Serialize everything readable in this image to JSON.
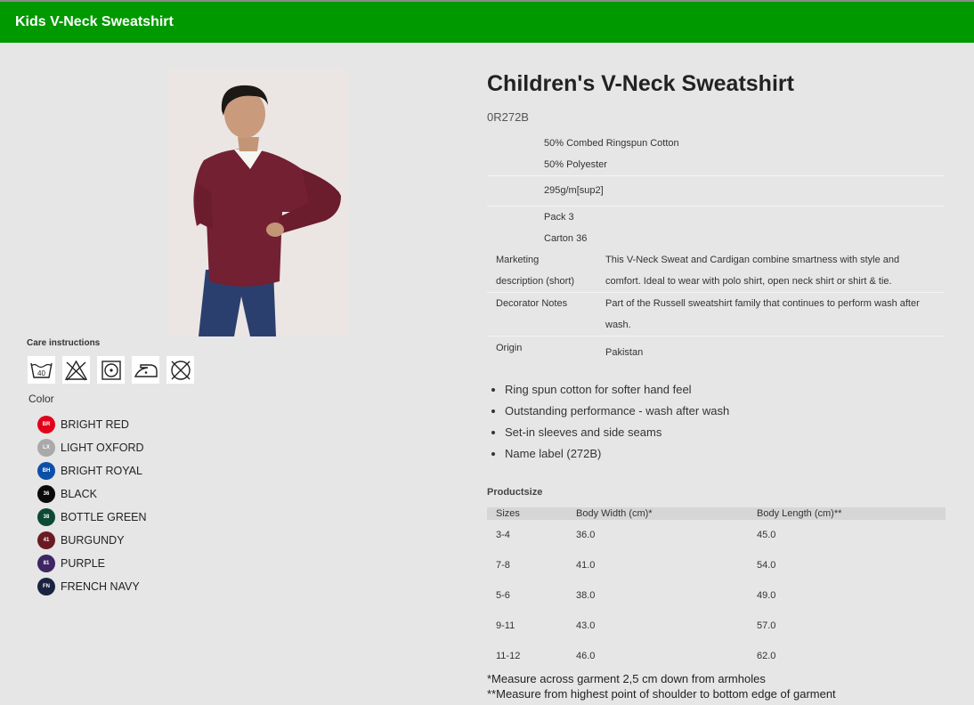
{
  "header": {
    "title": "Kids V-Neck Sweatshirt",
    "bg": "#009900"
  },
  "care": {
    "label": "Care instructions",
    "icons": [
      "wash-40-icon",
      "do-not-bleach-icon",
      "tumble-dry-icon",
      "iron-low-icon",
      "do-not-dry-clean-icon"
    ]
  },
  "colors": {
    "label": "Color",
    "items": [
      {
        "code": "BR",
        "name": "BRIGHT RED",
        "hex": "#e3001b"
      },
      {
        "code": "LX",
        "name": "LIGHT OXFORD",
        "hex": "#a9a9a9"
      },
      {
        "code": "BH",
        "name": "BRIGHT ROYAL",
        "hex": "#0d4fa8"
      },
      {
        "code": "36",
        "name": "BLACK",
        "hex": "#0a0a0a"
      },
      {
        "code": "38",
        "name": "BOTTLE GREEN",
        "hex": "#0d4a34"
      },
      {
        "code": "41",
        "name": "BURGUNDY",
        "hex": "#6b1a24"
      },
      {
        "code": "81",
        "name": "PURPLE",
        "hex": "#3e2563"
      },
      {
        "code": "FN",
        "name": "FRENCH NAVY",
        "hex": "#1a2340"
      }
    ]
  },
  "product": {
    "title": "Children's V-Neck Sweatshirt",
    "code": "0R272B",
    "spec": {
      "material": [
        "50% Combed Ringspun Cotton",
        "50% Polyester"
      ],
      "weight": "295g/m[sup2]",
      "packing": [
        "Pack 3",
        "Carton 36"
      ],
      "marketing_label": [
        "Marketing",
        "description (short)"
      ],
      "marketing_value": [
        "This V-Neck Sweat and Cardigan combine smartness with style and",
        "comfort. Ideal to wear with polo shirt, open neck shirt or shirt & tie."
      ],
      "decorator_label": "Decorator Notes",
      "decorator_value": [
        "Part of the Russell sweatshirt family that continues to perform wash after",
        "wash."
      ],
      "origin_label": "Origin",
      "origin_value": "Pakistan"
    },
    "features": [
      "Ring spun cotton for softer hand feel",
      "Outstanding performance - wash after wash",
      "Set-in sleeves and side seams",
      "Name label (272B)"
    ]
  },
  "productsize": {
    "label": "Productsize",
    "headers": [
      "Sizes",
      "Body Width (cm)*",
      "Body Length (cm)**"
    ],
    "rows": [
      [
        "3-4",
        "36.0",
        "45.0"
      ],
      [
        "7-8",
        "41.0",
        "54.0"
      ],
      [
        "5-6",
        "38.0",
        "49.0"
      ],
      [
        "9-11",
        "43.0",
        "57.0"
      ],
      [
        "11-12",
        "46.0",
        "62.0"
      ]
    ],
    "notes": [
      "*Measure across garment 2,5 cm down from armholes",
      "**Measure from highest point of shoulder to bottom edge of garment"
    ]
  }
}
